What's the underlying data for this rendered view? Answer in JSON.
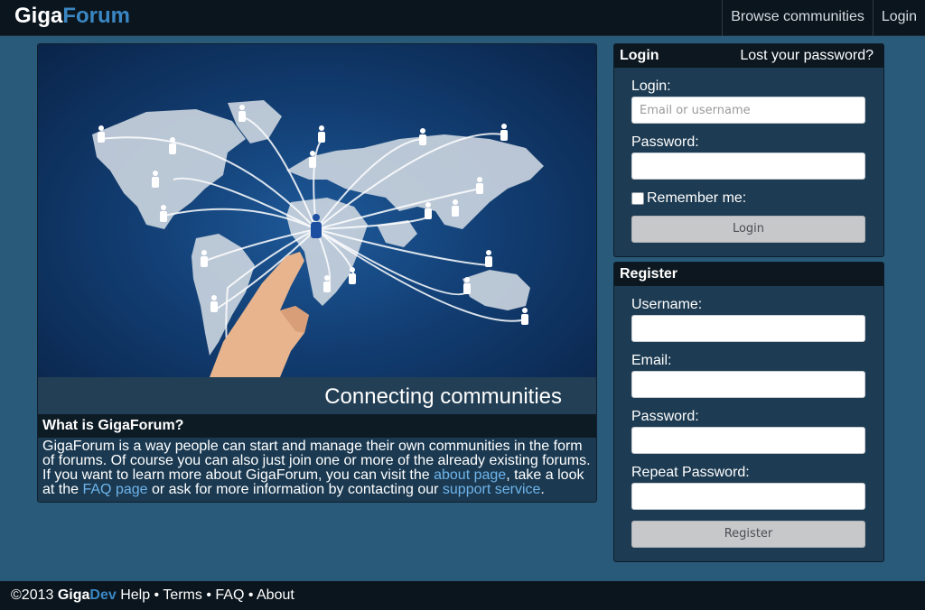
{
  "header": {
    "logo_part1": "Giga",
    "logo_part2": "Forum",
    "nav": [
      "Browse communities",
      "Login"
    ]
  },
  "hero": {
    "tagline": "Connecting communities",
    "image_description_icon": "world-map-network-icon"
  },
  "about": {
    "heading": "What is GigaForum?",
    "text_1": "GigaForum is a way people can start and manage their own communities in the form of forums. Of course you can also just join one or more of the already existing forums. If you want to learn more about GigaForum, you can visit the ",
    "link_about": "about page",
    "text_2": ", take a look at the ",
    "link_faq": "FAQ page",
    "text_3": " or ask for more information by contacting our ",
    "link_support": "support service",
    "text_4": "."
  },
  "login": {
    "title": "Login",
    "lost_password": "Lost your password?",
    "login_label": "Login:",
    "login_placeholder": "Email or username",
    "login_value": "",
    "password_label": "Password:",
    "password_value": "",
    "remember_label": "Remember me:",
    "remember_checked": false,
    "button": "Login"
  },
  "register": {
    "title": "Register",
    "username_label": "Username:",
    "email_label": "Email:",
    "password_label": "Password:",
    "repeat_label": "Repeat Password:",
    "button": "Register"
  },
  "footer": {
    "copyright": "©2013 ",
    "brand_1": "Giga",
    "brand_2": "Dev",
    "links": [
      "Help",
      "Terms",
      "FAQ",
      "About"
    ],
    "separator": " • "
  },
  "colors": {
    "background": "#295a7a",
    "bar": "#0b151d",
    "accent": "#3a87c4",
    "link": "#6fb4ea"
  }
}
